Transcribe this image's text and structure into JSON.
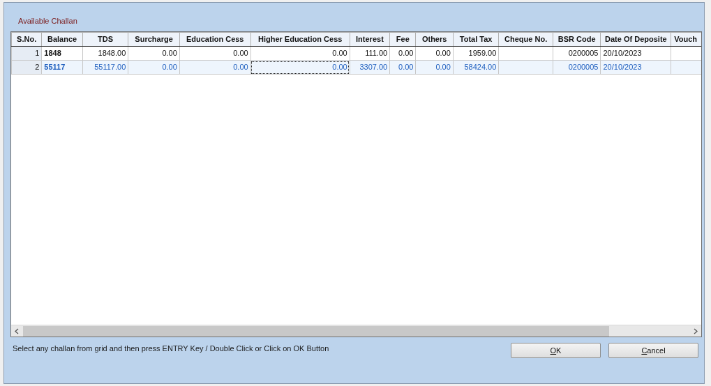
{
  "dialog": {
    "title": "Available Challan"
  },
  "table": {
    "columns": [
      "S.No.",
      "Balance",
      "TDS",
      "Surcharge",
      "Education Cess",
      "Higher Education Cess",
      "Interest",
      "Fee",
      "Others",
      "Total Tax",
      "Cheque No.",
      "BSR Code",
      "Date Of Deposite",
      "Vouch"
    ],
    "rows": [
      {
        "selected": false,
        "cells": [
          "1",
          "1848",
          "1848.00",
          "0.00",
          "0.00",
          "0.00",
          "111.00",
          "0.00",
          "0.00",
          "1959.00",
          "",
          "0200005",
          "20/10/2023",
          ""
        ]
      },
      {
        "selected": true,
        "cells": [
          "2",
          "55117",
          "55117.00",
          "0.00",
          "0.00",
          {
            "text": "0.00",
            "focused": true
          },
          "3307.00",
          "0.00",
          "0.00",
          "58424.00",
          "",
          "0200005",
          "20/10/2023",
          ""
        ]
      }
    ]
  },
  "hint": "Select any challan from grid and then press ENTRY Key / Double Click or Click on OK Button",
  "buttons": [
    "OK",
    "Cancel"
  ]
}
